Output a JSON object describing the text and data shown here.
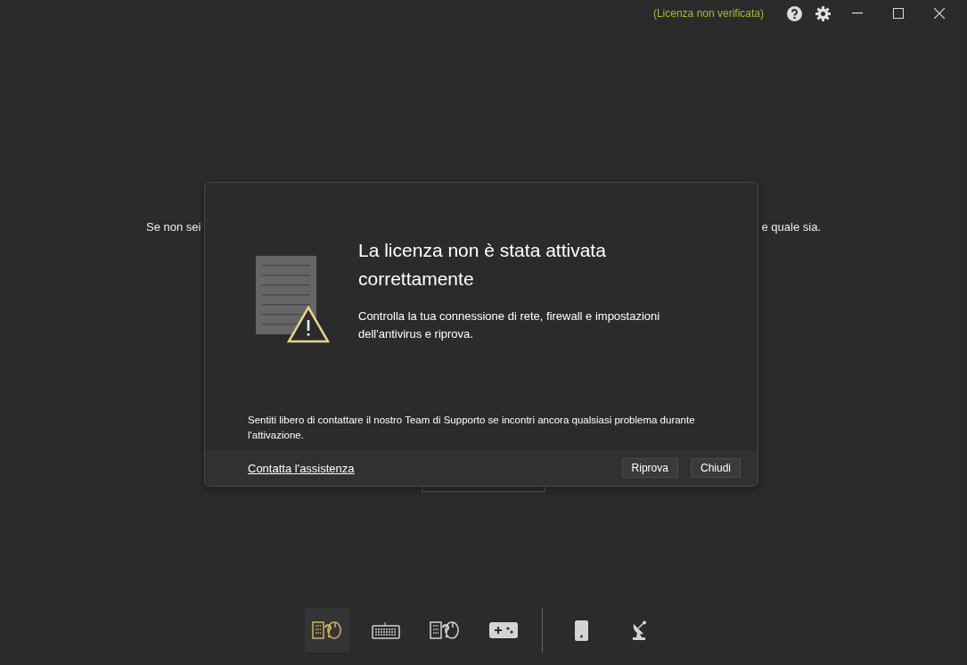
{
  "title_bar": {
    "license_status": "(Licenza non verificata)"
  },
  "background": {
    "text_left": "Se non sei",
    "text_right": "e quale sia."
  },
  "dialog": {
    "title": "La licenza non è stata attivata correttamente",
    "message": "Controlla la tua connessione di rete, firewall e impostazioni dell'antivirus e riprova.",
    "note": "Sentiti libero di contattare il nostro Team di Supporto se incontri ancora qualsiasi problema durante l'attivazione.",
    "link": "Contatta l'assistenza",
    "buttons": [
      "Riprova",
      "Chiudi"
    ]
  },
  "bottom_nav": [
    {
      "kind": "combo",
      "selected": true
    },
    {
      "kind": "keyboard",
      "selected": false
    },
    {
      "kind": "combo",
      "selected": false
    },
    {
      "kind": "gamepad",
      "selected": false
    },
    {
      "kind": "divider"
    },
    {
      "kind": "phone",
      "selected": false
    },
    {
      "kind": "dish",
      "selected": false
    }
  ]
}
